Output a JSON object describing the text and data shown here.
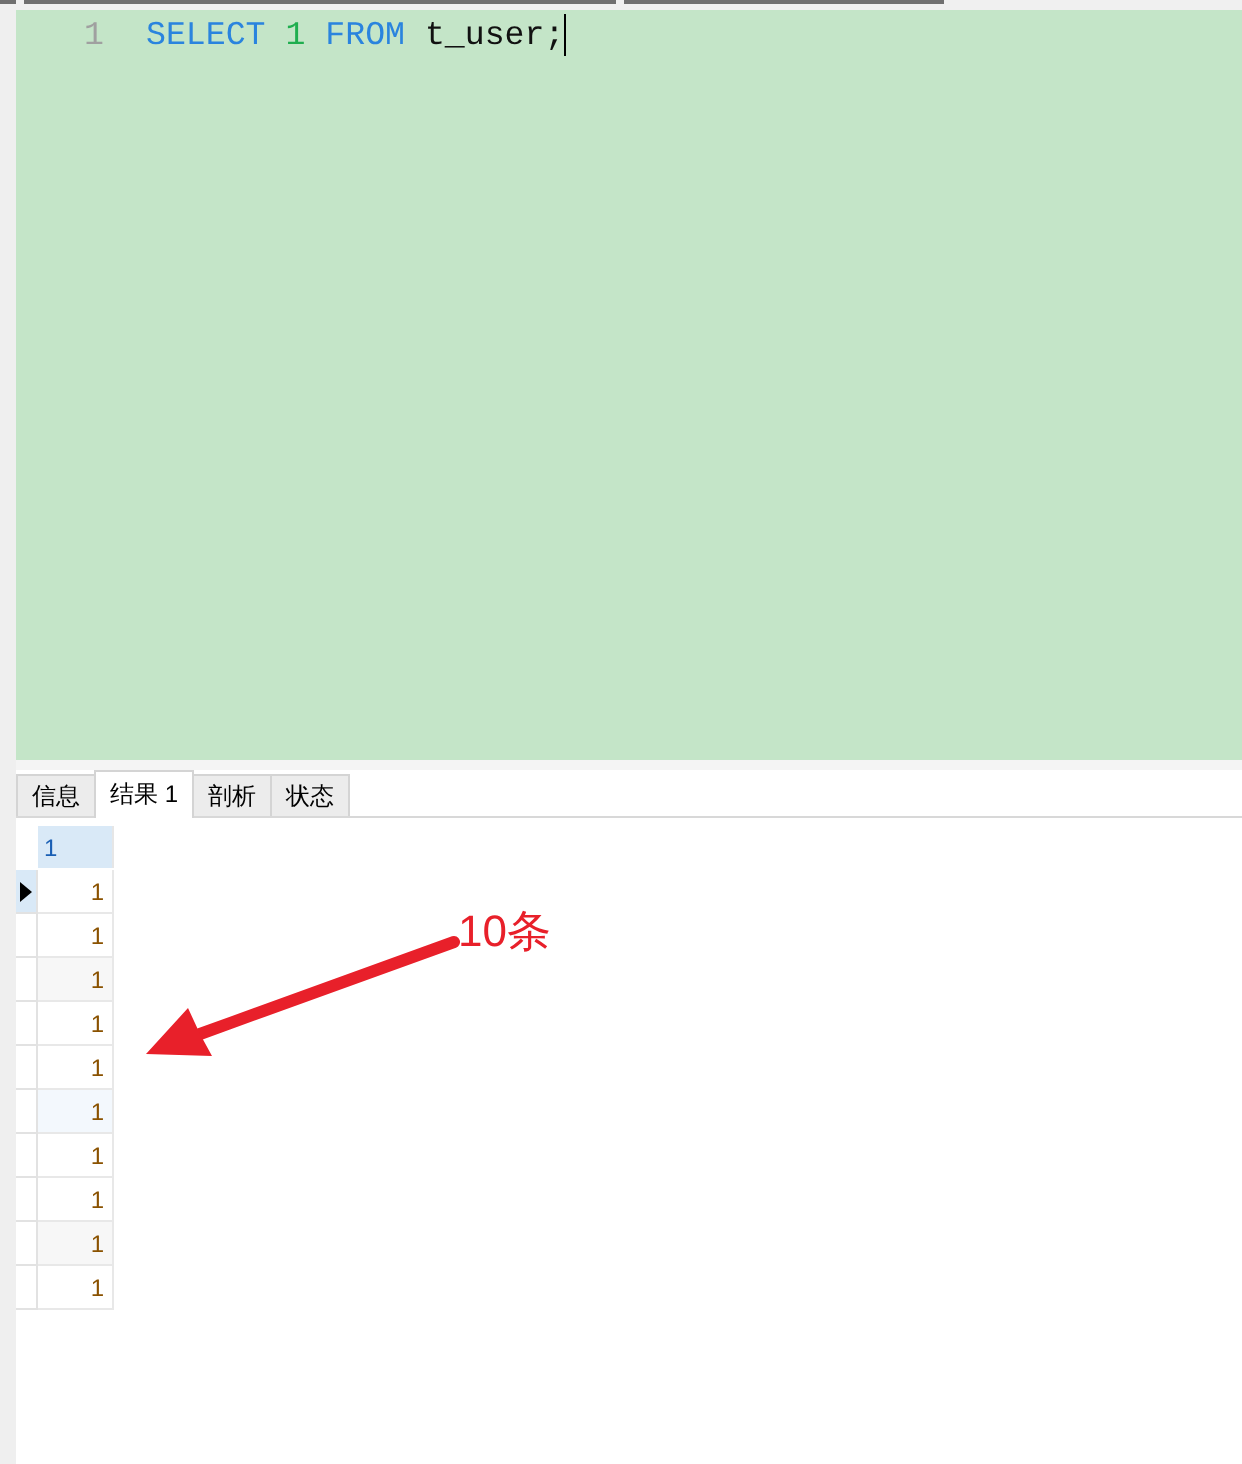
{
  "editor": {
    "line_number": "1",
    "tokens": [
      {
        "kind": "keyword",
        "text": "SELECT"
      },
      {
        "kind": "number",
        "text": "1"
      },
      {
        "kind": "keyword",
        "text": "FROM"
      },
      {
        "kind": "identifier",
        "text": "t_user;"
      }
    ],
    "caret": true
  },
  "tabs": [
    {
      "label": "信息",
      "selected": false
    },
    {
      "label": "结果 1",
      "selected": true
    },
    {
      "label": "剖析",
      "selected": false
    },
    {
      "label": "状态",
      "selected": false
    }
  ],
  "result": {
    "columns": [
      "1"
    ],
    "rows": [
      {
        "cells": [
          "1"
        ],
        "selected": true,
        "color": "#ffffff"
      },
      {
        "cells": [
          "1"
        ],
        "selected": false,
        "color": "#ffffff"
      },
      {
        "cells": [
          "1"
        ],
        "selected": false,
        "color": "#f7f7f7"
      },
      {
        "cells": [
          "1"
        ],
        "selected": false,
        "color": "#ffffff"
      },
      {
        "cells": [
          "1"
        ],
        "selected": false,
        "color": "#ffffff"
      },
      {
        "cells": [
          "1"
        ],
        "selected": false,
        "color": "#f3f8fd"
      },
      {
        "cells": [
          "1"
        ],
        "selected": false,
        "color": "#ffffff"
      },
      {
        "cells": [
          "1"
        ],
        "selected": false,
        "color": "#ffffff"
      },
      {
        "cells": [
          "1"
        ],
        "selected": false,
        "color": "#f7f7f7"
      },
      {
        "cells": [
          "1"
        ],
        "selected": false,
        "color": "#ffffff"
      }
    ]
  },
  "annotation": {
    "label": "10条"
  }
}
